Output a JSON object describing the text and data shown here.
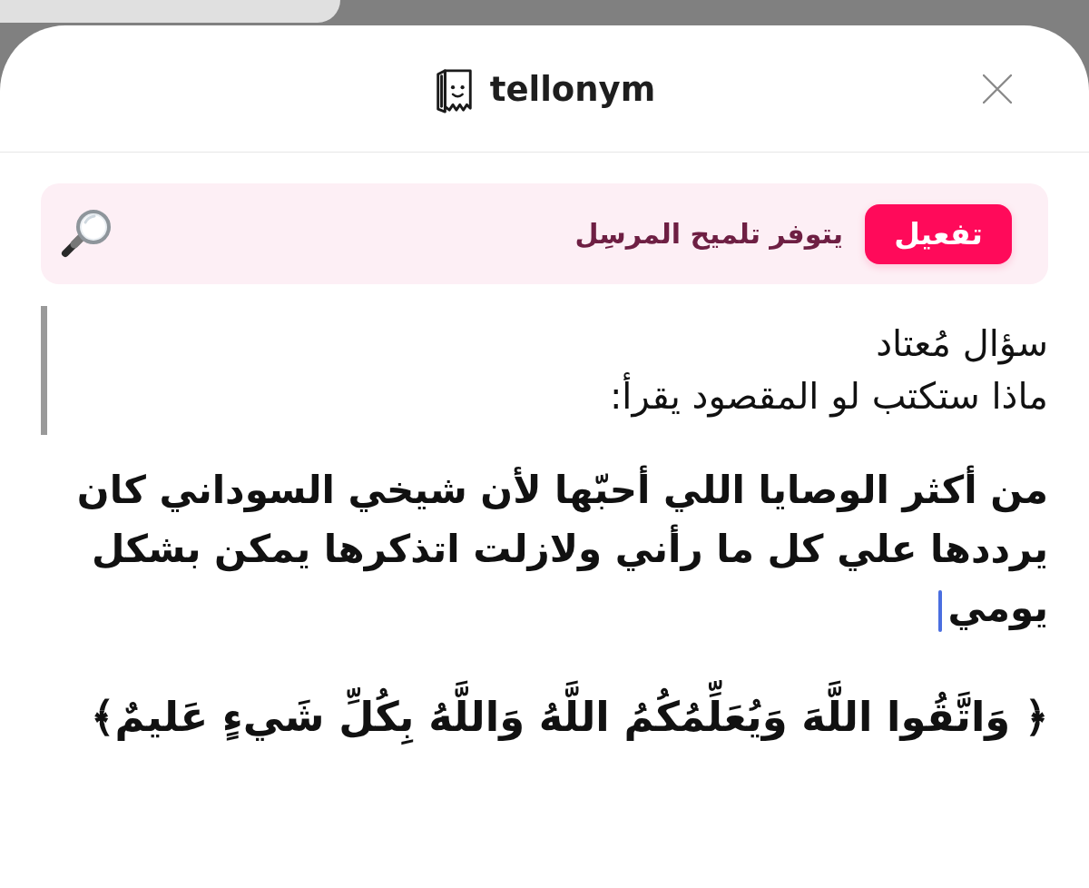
{
  "header": {
    "logo_text": "tellonym"
  },
  "banner": {
    "button": "تفعيل",
    "text": "يتوفر تلميح المرسِل"
  },
  "question": {
    "title": "سؤال مُعتاد",
    "text": "ماذا ستكتب لو المقصود يقرأ:"
  },
  "answer": {
    "paragraphs": [
      {
        "text": "من أكثر الوصايا اللي أحبّها لأن شيخي السوداني كان يرددها علي كل ما رأني ولازلت اتذكرها يمكن بشكل يومي",
        "caret": true
      },
      {
        "text": "﴿ وَاتَّقُوا اللَّهَ وَيُعَلِّمُكُمُ اللَّهُ وَاللَّهُ بِكُلِّ شَيءٍ عَليمٌ﴾",
        "caret": false
      }
    ]
  }
}
